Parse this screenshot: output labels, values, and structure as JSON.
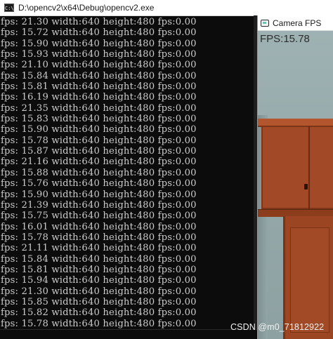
{
  "console_window": {
    "title": "D:\\opencv2\\x64\\Debug\\opencv2.exe",
    "lines": [
      "fps: 21.30 width:640 height:480 fps:0.00",
      "fps: 15.72 width:640 height:480 fps:0.00",
      "fps: 15.90 width:640 height:480 fps:0.00",
      "fps: 15.93 width:640 height:480 fps:0.00",
      "fps: 21.10 width:640 height:480 fps:0.00",
      "fps: 15.84 width:640 height:480 fps:0.00",
      "fps: 15.81 width:640 height:480 fps:0.00",
      "fps: 16.19 width:640 height:480 fps:0.00",
      "fps: 21.35 width:640 height:480 fps:0.00",
      "fps: 15.83 width:640 height:480 fps:0.00",
      "fps: 15.90 width:640 height:480 fps:0.00",
      "fps: 15.78 width:640 height:480 fps:0.00",
      "fps: 15.87 width:640 height:480 fps:0.00",
      "fps: 21.16 width:640 height:480 fps:0.00",
      "fps: 15.88 width:640 height:480 fps:0.00",
      "fps: 15.76 width:640 height:480 fps:0.00",
      "fps: 15.90 width:640 height:480 fps:0.00",
      "fps: 21.39 width:640 height:480 fps:0.00",
      "fps: 15.75 width:640 height:480 fps:0.00",
      "fps: 16.01 width:640 height:480 fps:0.00",
      "fps: 15.78 width:640 height:480 fps:0.00",
      "fps: 21.11 width:640 height:480 fps:0.00",
      "fps: 15.84 width:640 height:480 fps:0.00",
      "fps: 15.81 width:640 height:480 fps:0.00",
      "fps: 15.94 width:640 height:480 fps:0.00",
      "fps: 21.30 width:640 height:480 fps:0.00",
      "fps: 15.85 width:640 height:480 fps:0.00",
      "fps: 15.82 width:640 height:480 fps:0.00",
      "fps: 15.78 width:640 height:480 fps:0.00"
    ]
  },
  "camera_window": {
    "title": "Camera FPS",
    "fps_overlay": "FPS:15.78"
  },
  "watermark": "CSDN @m0_71812922",
  "colors": {
    "console_background": "#0c0c0c",
    "console_text": "#cccccc",
    "cabinet_wood": "#a24a27",
    "wall": "#9fb2b3"
  },
  "icons": {
    "console_app": "console-app-icon",
    "camera_app": "camera-app-icon"
  }
}
